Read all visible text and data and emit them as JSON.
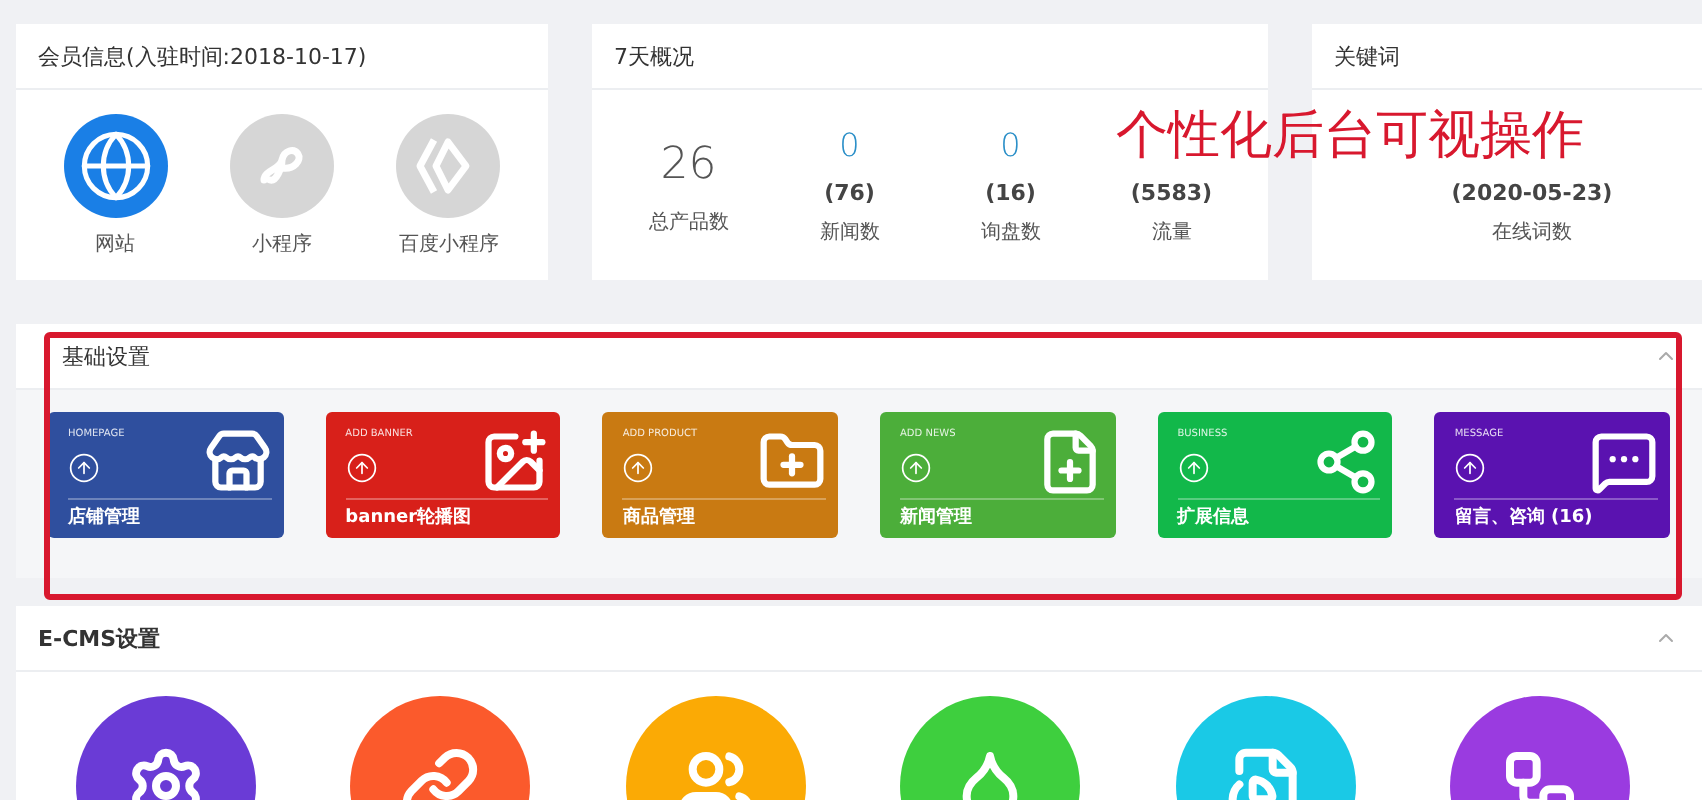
{
  "member": {
    "title": "会员信息(入驻时间:2018-10-17)",
    "items": [
      {
        "label": "网站",
        "selected": true
      },
      {
        "label": "小程序",
        "selected": false
      },
      {
        "label": "百度小程序",
        "selected": false
      }
    ]
  },
  "overview": {
    "title": "7天概况",
    "stats": [
      {
        "kind": "big",
        "value": "26",
        "label": "总产品数"
      },
      {
        "kind": "pair",
        "value": "0",
        "count": "(76)",
        "label": "新闻数"
      },
      {
        "kind": "pair",
        "value": "0",
        "count": "(16)",
        "label": "询盘数"
      },
      {
        "kind": "pair",
        "count": "(5583)",
        "label": "流量"
      }
    ]
  },
  "keywords": {
    "title": "关键词",
    "count": "(2020-05-23)",
    "label": "在线词数"
  },
  "overlay": {
    "text": "个性化后台可视操作"
  },
  "basic": {
    "title": "基础设置",
    "tiles": [
      {
        "tag": "HOMEPAGE",
        "label": "店铺管理",
        "color": "#2f4f9e"
      },
      {
        "tag": "ADD BANNER",
        "label": "banner轮播图",
        "color": "#d8201a"
      },
      {
        "tag": "ADD PRODUCT",
        "label": "商品管理",
        "color": "#c97a12"
      },
      {
        "tag": "ADD NEWS",
        "label": "新闻管理",
        "color": "#4cae3a"
      },
      {
        "tag": "BUSINESS",
        "label": "扩展信息",
        "color": "#12b84a"
      },
      {
        "tag": "MESSAGE",
        "label": "留言、咨询 (16)",
        "color": "#5a12b0"
      }
    ]
  },
  "ecms": {
    "title": "E-CMS设置",
    "circles": [
      {
        "color": "#6a3bd6"
      },
      {
        "color": "#fb5a2c"
      },
      {
        "color": "#fbaa05"
      },
      {
        "color": "#3ecf3e"
      },
      {
        "color": "#1ac9e6"
      },
      {
        "color": "#9a3be0"
      }
    ]
  }
}
